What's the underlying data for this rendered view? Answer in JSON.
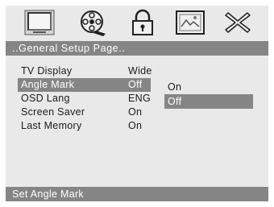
{
  "toolbar": {
    "icons": [
      {
        "name": "tv-display-icon"
      },
      {
        "name": "audio-reel-icon"
      },
      {
        "name": "lock-icon"
      },
      {
        "name": "picture-icon"
      },
      {
        "name": "close-icon"
      }
    ]
  },
  "title": "..General Setup Page..",
  "menu": {
    "items": [
      {
        "label": "TV Display",
        "value": "Wide"
      },
      {
        "label": "Angle Mark",
        "value": "Off"
      },
      {
        "label": "OSD Lang",
        "value": "ENG"
      },
      {
        "label": "Screen Saver",
        "value": "On"
      },
      {
        "label": "Last Memory",
        "value": "On"
      }
    ],
    "selected_index": 1
  },
  "submenu": {
    "options": [
      "On",
      "Off"
    ],
    "selected_index": 1
  },
  "status": "Set Angle Mark",
  "colors": {
    "background": "#e9e9e9",
    "highlight": "#858585",
    "text": "#1a1a1a",
    "highlight_text": "#ffffff"
  }
}
